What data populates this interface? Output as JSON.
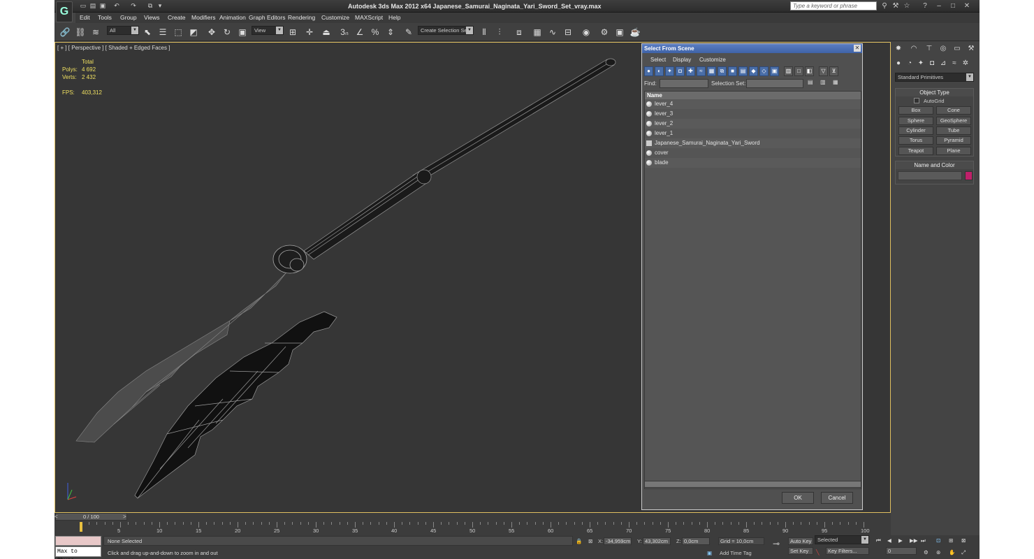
{
  "window": {
    "title": "Autodesk 3ds Max  2012 x64      Japanese_Samurai_Naginata_Yari_Sword_Set_vray.max",
    "search_placeholder": "Type a keyword or phrase"
  },
  "menu": [
    "Edit",
    "Tools",
    "Group",
    "Views",
    "Create",
    "Modifiers",
    "Animation",
    "Graph Editors",
    "Rendering",
    "Customize",
    "MAXScript",
    "Help"
  ],
  "toolbar": {
    "selection_filter": "All",
    "reference_coord": "View",
    "selection_set": "Create Selection Se"
  },
  "viewport": {
    "label": "[ + ] [ Perspective ] [ Shaded + Edged Faces ]",
    "stats": {
      "total_label": "Total",
      "polys_label": "Polys:",
      "polys_value": "4 692",
      "verts_label": "Verts:",
      "verts_value": "2 432",
      "fps_label": "FPS:",
      "fps_value": "403,312"
    }
  },
  "dialog": {
    "title": "Select From Scene",
    "menu": [
      "Select",
      "Display",
      "Customize"
    ],
    "find_label": "Find:",
    "selection_set_label": "Selection Set:",
    "column_name": "Name",
    "objects": [
      "lever_4",
      "lever_3",
      "lever_2",
      "lever_1",
      "Japanese_Samurai_Naginata_Yari_Sword",
      "cover",
      "blade"
    ],
    "ok_label": "OK",
    "cancel_label": "Cancel"
  },
  "command_panel": {
    "category": "Standard Primitives",
    "object_type_title": "Object Type",
    "autogrid_label": "AutoGrid",
    "primitives": [
      "Box",
      "Cone",
      "Sphere",
      "GeoSphere",
      "Cylinder",
      "Tube",
      "Torus",
      "Pyramid",
      "Teapot",
      "Plane"
    ],
    "name_color_title": "Name and Color",
    "object_color": "#c0206a"
  },
  "timeline": {
    "slider_label": "0 / 100",
    "ticks": [
      "5",
      "10",
      "15",
      "20",
      "25",
      "30",
      "35",
      "40",
      "45",
      "50",
      "55",
      "60",
      "65",
      "70",
      "75",
      "80",
      "85",
      "90",
      "95",
      "100"
    ]
  },
  "status": {
    "maxscript_label": "Max to Physc.",
    "selection_text": "None Selected",
    "prompt_text": "Click and drag up-and-down to zoom in and out",
    "x_label": "X:",
    "x_value": "-34,959cm",
    "y_label": "Y:",
    "y_value": "43,302cm",
    "z_label": "Z:",
    "z_value": "0,0cm",
    "grid_text": "Grid = 10,0cm",
    "add_time_tag": "Add Time Tag",
    "auto_key": "Auto Key",
    "set_key": "Set Key",
    "key_mode": "Selected",
    "key_filters": "Key Filters...",
    "frame_value": "0"
  }
}
